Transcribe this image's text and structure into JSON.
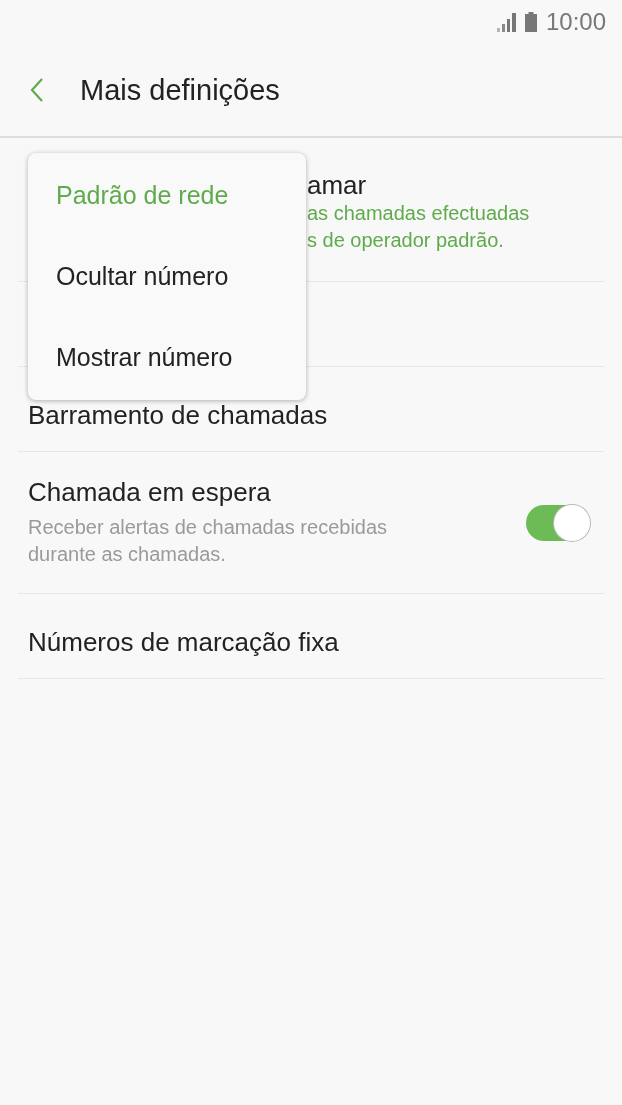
{
  "status_bar": {
    "time": "10:00"
  },
  "app_bar": {
    "title": "Mais definições"
  },
  "rows": [
    {
      "kind": "partial",
      "title": "amar",
      "subtitle_lines": [
        "as chamadas efectuadas",
        "s de operador padrão."
      ]
    },
    {
      "kind": "covered"
    },
    {
      "kind": "plain",
      "title": "Barramento de chamadas"
    },
    {
      "kind": "switch",
      "title": "Chamada em espera",
      "subtitle": "Receber alertas de chamadas recebidas durante as chamadas.",
      "on": true
    },
    {
      "kind": "plain",
      "title": "Números de marcação fixa"
    }
  ],
  "popup": {
    "options": [
      {
        "label": "Padrão de rede",
        "selected": true
      },
      {
        "label": "Ocultar número",
        "selected": false
      },
      {
        "label": "Mostrar número",
        "selected": false
      }
    ]
  }
}
